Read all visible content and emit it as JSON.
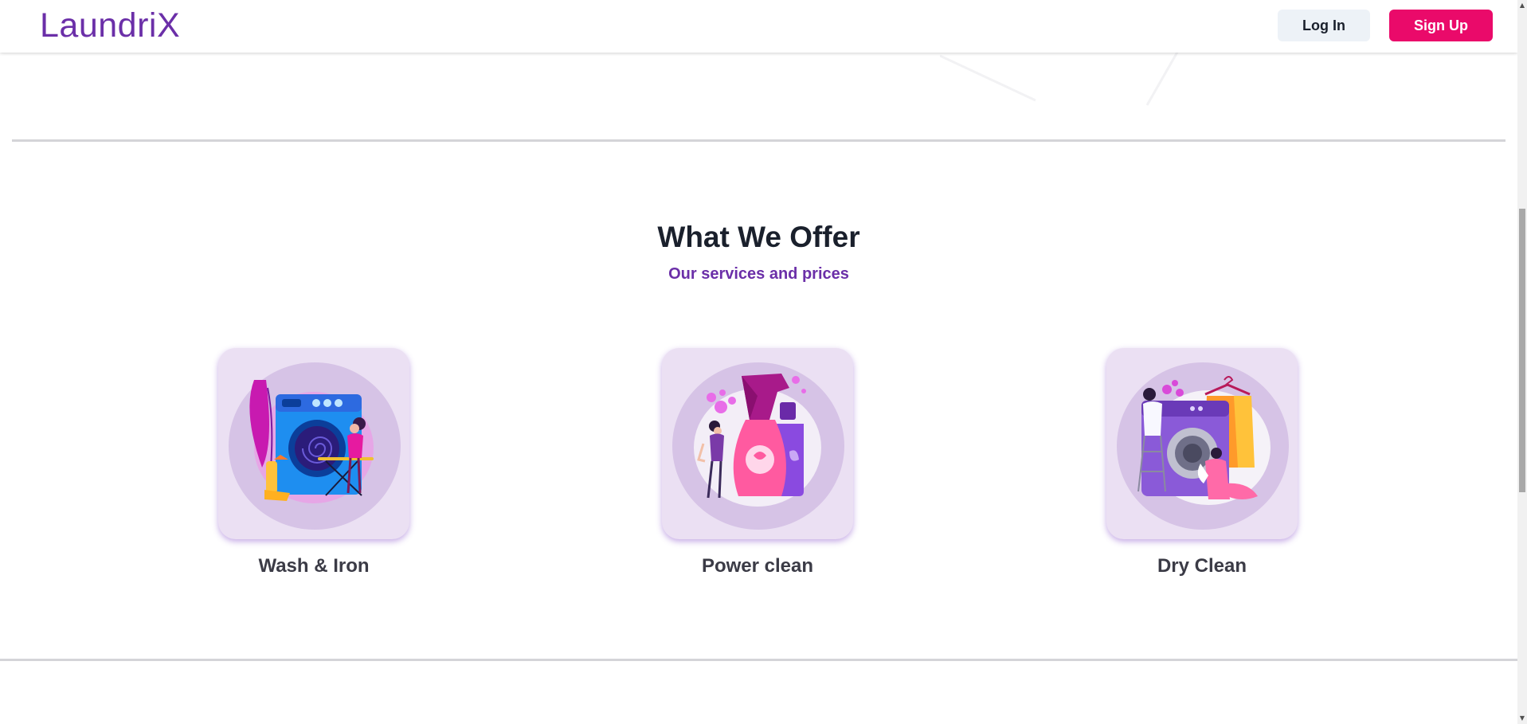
{
  "header": {
    "logo": "LaundriX",
    "login_label": "Log In",
    "signup_label": "Sign Up"
  },
  "offer": {
    "title": "What We Offer",
    "subtitle": "Our services and prices",
    "services": [
      {
        "label": "Wash & Iron",
        "icon": "washing-machine-ironing-icon"
      },
      {
        "label": "Power clean",
        "icon": "spray-bottle-icon"
      },
      {
        "label": "Dry Clean",
        "icon": "dry-clean-machine-icon"
      }
    ]
  },
  "colors": {
    "brand": "#6b2fa8",
    "signup": "#ea0a6a",
    "login_bg": "#edf2f7",
    "card_bg": "#ebe0f3"
  }
}
